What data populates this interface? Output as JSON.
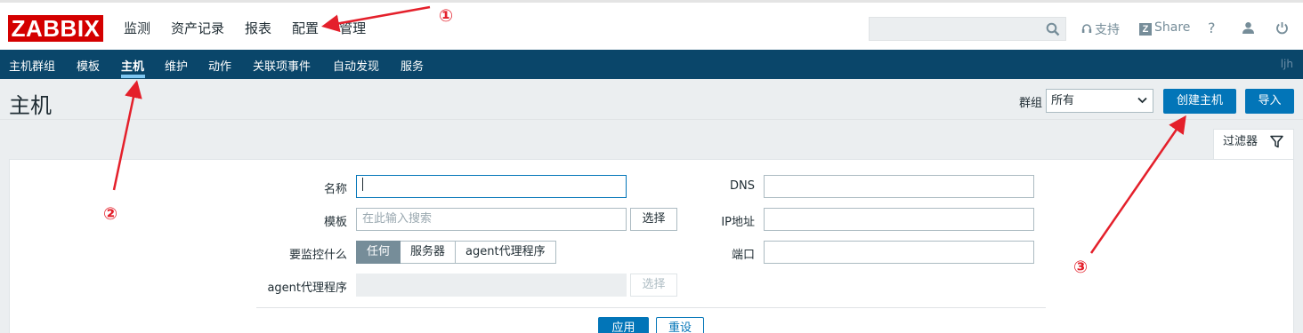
{
  "logo": "ZABBIX",
  "main_nav": [
    "监测",
    "资产记录",
    "报表",
    "配置",
    "管理"
  ],
  "top_links": {
    "support": "支持",
    "share": "Share",
    "help": "?"
  },
  "sub_nav": [
    "主机群组",
    "模板",
    "主机",
    "维护",
    "动作",
    "关联项事件",
    "自动发现",
    "服务"
  ],
  "sub_nav_active": "主机",
  "user": "ljh",
  "page": {
    "title": "主机",
    "group_label": "群组",
    "group_value": "所有",
    "create_button": "创建主机",
    "import_button": "导入"
  },
  "filter": {
    "tab_label": "过滤器",
    "name_label": "名称",
    "name_value": "",
    "template_label": "模板",
    "template_placeholder": "在此输入搜索",
    "select_label": "选择",
    "monitored_by_label": "要监控什么",
    "monitored_by_options": [
      "任何",
      "服务器",
      "agent代理程序"
    ],
    "monitored_by_selected": "任何",
    "proxy_label": "agent代理程序",
    "proxy_select_label": "选择",
    "dns_label": "DNS",
    "ip_label": "IP地址",
    "port_label": "端口",
    "apply_button": "应用",
    "reset_button": "重设"
  },
  "annotations": {
    "marker_1": "①",
    "marker_2": "②",
    "marker_3": "③",
    "color": "#e4202b"
  },
  "colors": {
    "brand_red": "#d40000",
    "subnav_bg": "#0a466a",
    "primary": "#0275b8",
    "active_underline": "#7ec6f1"
  }
}
